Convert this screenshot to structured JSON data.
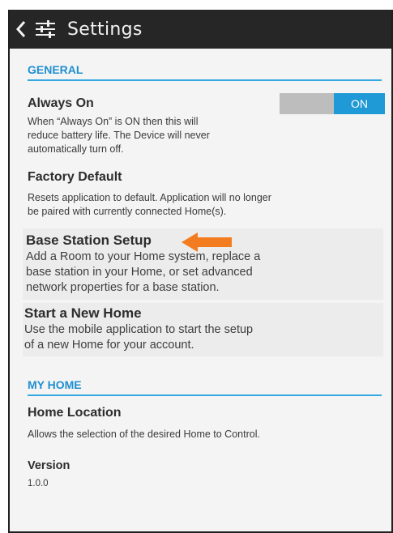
{
  "header": {
    "title": "Settings",
    "back_icon": "chevron-left-icon",
    "menu_icon": "sliders-icon"
  },
  "general": {
    "header": "GENERAL",
    "always_on": {
      "title": "Always On",
      "desc_lines": [
        "When “Always On” is ON then this will",
        "reduce battery life. The Device will never",
        "automatically turn off."
      ],
      "toggle_label": "ON"
    },
    "factory_default": {
      "title": "Factory Default",
      "desc_lines": [
        "Resets application to default. Application will no longer",
        "be paired with currently connected Home(s)."
      ]
    },
    "base_station": {
      "title": "Base Station Setup",
      "desc_lines": [
        "Add a Room to your Home system, replace a",
        "base station in your Home, or set advanced",
        "network properties for a base station."
      ]
    },
    "new_home": {
      "title": "Start a New Home",
      "desc_lines": [
        "Use the mobile application to start the setup",
        "of a new Home for your account."
      ]
    }
  },
  "my_home": {
    "header": "MY HOME",
    "home_location": {
      "title": "Home Location",
      "desc": "Allows the selection of the desired Home to Control."
    },
    "version": {
      "title": "Version",
      "value": "1.0.0"
    }
  },
  "colors": {
    "accent": "#1f8fd0",
    "toggle_on": "#1f9ad6",
    "topbar": "#262626",
    "arrow": "#f47c20"
  }
}
